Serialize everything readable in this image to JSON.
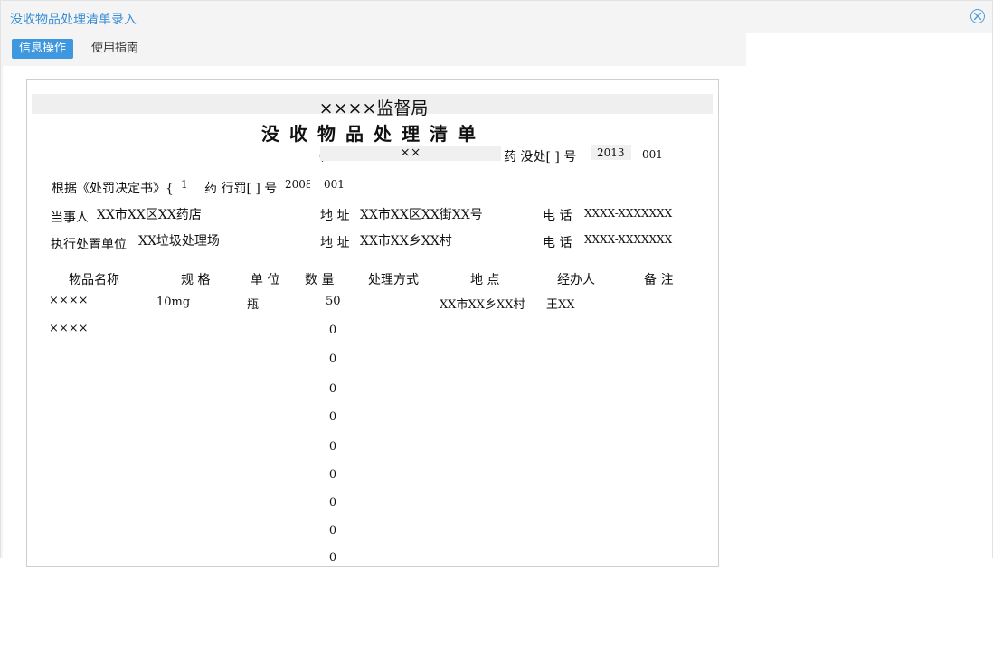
{
  "window": {
    "title": "没收物品处理清单录入"
  },
  "tabs": [
    {
      "label": "信息操作"
    },
    {
      "label": "使用指南"
    }
  ],
  "document": {
    "bureau": "××××监督局",
    "title": "没收物品处理清单",
    "number_line": {
      "paren": "（",
      "area": "××",
      "mid": "药 没处[ ] 号",
      "year": "2013",
      "serial": "001"
    },
    "basis": {
      "prefix": "根据《处罚决定书》{",
      "num1": "1",
      "mid": "药 行罚[ ] 号",
      "year": "2008",
      "serial": "001"
    },
    "party": {
      "label": "当事人",
      "value": "XX市XX区XX药店"
    },
    "address1": {
      "label": "地 址",
      "value": "XX市XX区XX街XX号"
    },
    "phone1": {
      "label": "电 话",
      "value": "XXXX-XXXXXXX"
    },
    "executor": {
      "label": "执行处置单位",
      "value": "XX垃圾处理场"
    },
    "address2": {
      "label": "地 址",
      "value": "XX市XX乡XX村"
    },
    "phone2": {
      "label": "电 话",
      "value": "XXXX-XXXXXXX"
    },
    "columns": [
      "物品名称",
      "规 格",
      "单 位",
      "数 量",
      "处理方式",
      "地 点",
      "经办人",
      "备 注"
    ],
    "rows": [
      {
        "name": "××××",
        "spec": "10mg",
        "unit": "瓶",
        "qty": "50",
        "method": "",
        "place": "XX市XX乡XX村",
        "handler": "王XX",
        "note": ""
      },
      {
        "name": "××××",
        "spec": "",
        "unit": "",
        "qty": "0",
        "method": "",
        "place": "",
        "handler": "",
        "note": ""
      },
      {
        "qty": "0"
      },
      {
        "qty": "0"
      },
      {
        "qty": "0"
      },
      {
        "qty": "0"
      },
      {
        "qty": "0"
      },
      {
        "qty": "0"
      },
      {
        "qty": "0"
      },
      {
        "qty": "0"
      }
    ]
  }
}
